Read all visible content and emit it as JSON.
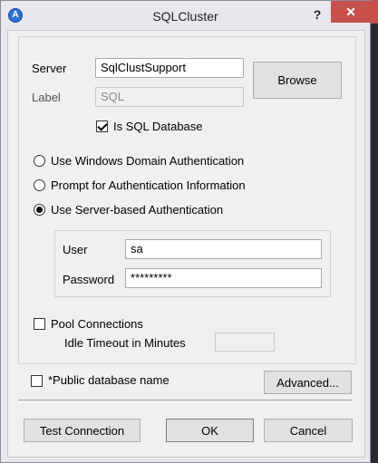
{
  "window": {
    "title": "SQLCluster",
    "app_icon_glyph": "A",
    "help_label": "?",
    "close_label": "✕"
  },
  "server": {
    "label": "Server",
    "value": "SqlClustSupport",
    "browse_label": "Browse"
  },
  "label_field": {
    "label": "Label",
    "value": "SQL"
  },
  "is_sql_database": {
    "label": "Is SQL Database",
    "checked": true
  },
  "auth": {
    "options": [
      {
        "label": "Use Windows Domain Authentication",
        "selected": false
      },
      {
        "label": "Prompt for Authentication Information",
        "selected": false
      },
      {
        "label": "Use Server-based Authentication",
        "selected": true
      }
    ]
  },
  "credentials": {
    "user_label": "User",
    "user_value": "sa",
    "password_label": "Password",
    "password_value": "*********"
  },
  "pool": {
    "label": "Pool Connections",
    "checked": false,
    "idle_timeout_label": "Idle Timeout in Minutes",
    "idle_timeout_value": ""
  },
  "public_db": {
    "label": "*Public database name",
    "checked": false,
    "advanced_label": "Advanced..."
  },
  "footer": {
    "test_label": "Test Connection",
    "ok_label": "OK",
    "cancel_label": "Cancel"
  },
  "colors": {
    "close_button": "#c7504b",
    "window_frame": "#e9e7ee",
    "client_bg": "#f0f0f0"
  }
}
